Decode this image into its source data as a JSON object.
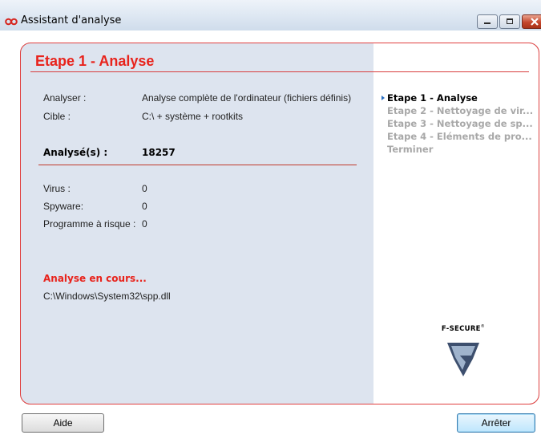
{
  "window": {
    "title": "Assistant d'analyse",
    "icon": "fsecure-infinity-icon",
    "controls": [
      "minimize-icon",
      "maximize-icon",
      "close-icon"
    ]
  },
  "colors": {
    "accent_red": "#e8231c",
    "left_pane_bg": "#dde4ef",
    "inactive_step": "#a8a8a8"
  },
  "header": {
    "step_title": "Etape 1 - Analyse"
  },
  "details": {
    "analyser_label": "Analyser :",
    "analyser_value": "Analyse complète de l'ordinateur (fichiers définis)",
    "cible_label": "Cible :",
    "cible_value": "C:\\  + système + rootkits"
  },
  "scanned": {
    "label": "Analysé(s) :",
    "value": "18257"
  },
  "counts": {
    "virus_label": "Virus :",
    "virus_value": "0",
    "spyware_label": "Spyware:",
    "spyware_value": "0",
    "risk_label": "Programme à risque :",
    "risk_value": "0"
  },
  "status": {
    "text": "Analyse en cours...",
    "current_file": "C:\\Windows\\System32\\spp.dll"
  },
  "steps": [
    "Etape 1 - Analyse",
    "Etape 2 - Nettoyage de vir...",
    "Etape 3 - Nettoyage de sp...",
    "Etape 4 - Eléments de pro...",
    "Terminer"
  ],
  "logo": {
    "text": "F-SECURE",
    "mark": "®"
  },
  "buttons": {
    "help": "Aide",
    "stop": "Arrêter"
  }
}
